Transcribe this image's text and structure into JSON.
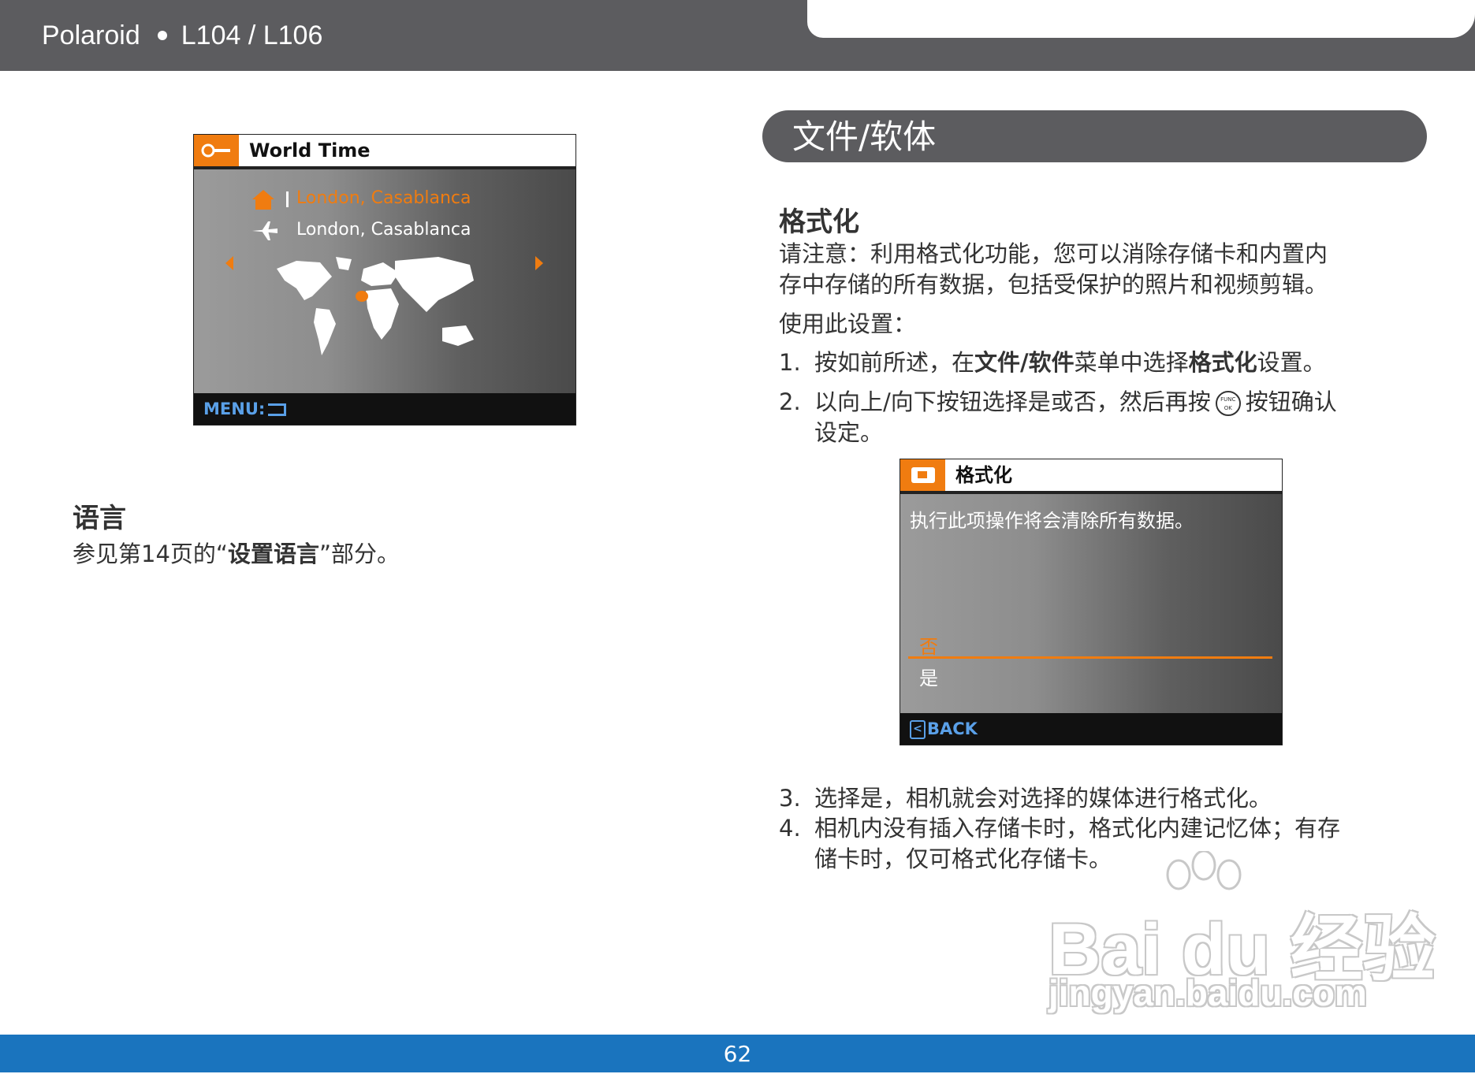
{
  "header": {
    "brand": "Polaroid",
    "model": "L104 / L106"
  },
  "left": {
    "world_time_screen": {
      "title": "World Time",
      "home_city": "London, Casablanca",
      "travel_city": "London, Casablanca",
      "footer": "MENU:"
    },
    "language": {
      "heading": "语言",
      "text_before": "参见第14页的“",
      "text_bold": "设置语言",
      "text_after": "”部分。"
    }
  },
  "right": {
    "section_title": "文件/软体",
    "format": {
      "heading": "格式化",
      "intro_line1": "请注意：利用格式化功能，您可以消除存储卡和内置内",
      "intro_line2": "存中存储的所有数据，包括受保护的照片和视频剪辑。",
      "usage": "使用此设置：",
      "steps": [
        {
          "num": "1.",
          "t1": "按如前所述，在",
          "b1": "文件/软件",
          "t2": "菜单中选择",
          "b2": "格式化",
          "t3": "设置。"
        },
        {
          "num": "2.",
          "line1a": "以向上/向下按钮选择是或否，然后再按",
          "line1b": "按钮确认",
          "line2": "设定。",
          "icon_top": "FUNC",
          "icon_bottom": "OK"
        },
        {
          "num": "3.",
          "text": "选择是，相机就会对选择的媒体进行格式化。"
        },
        {
          "num": "4.",
          "line1": "相机内没有插入存储卡时，格式化内建记忆体；有存",
          "line2": "储卡时，仅可格式化存储卡。"
        }
      ],
      "screen": {
        "title": "格式化",
        "message": "执行此项操作将会清除所有数据。",
        "option_no": "否",
        "option_yes": "是",
        "footer": "BACK"
      }
    }
  },
  "page_number": "62",
  "watermark": {
    "brand": "Bai du 经验",
    "url": "jingyan.baidu.com"
  },
  "colors": {
    "header_gray": "#5c5c5f",
    "footer_blue": "#1a74be",
    "accent_orange": "#f07c10"
  }
}
